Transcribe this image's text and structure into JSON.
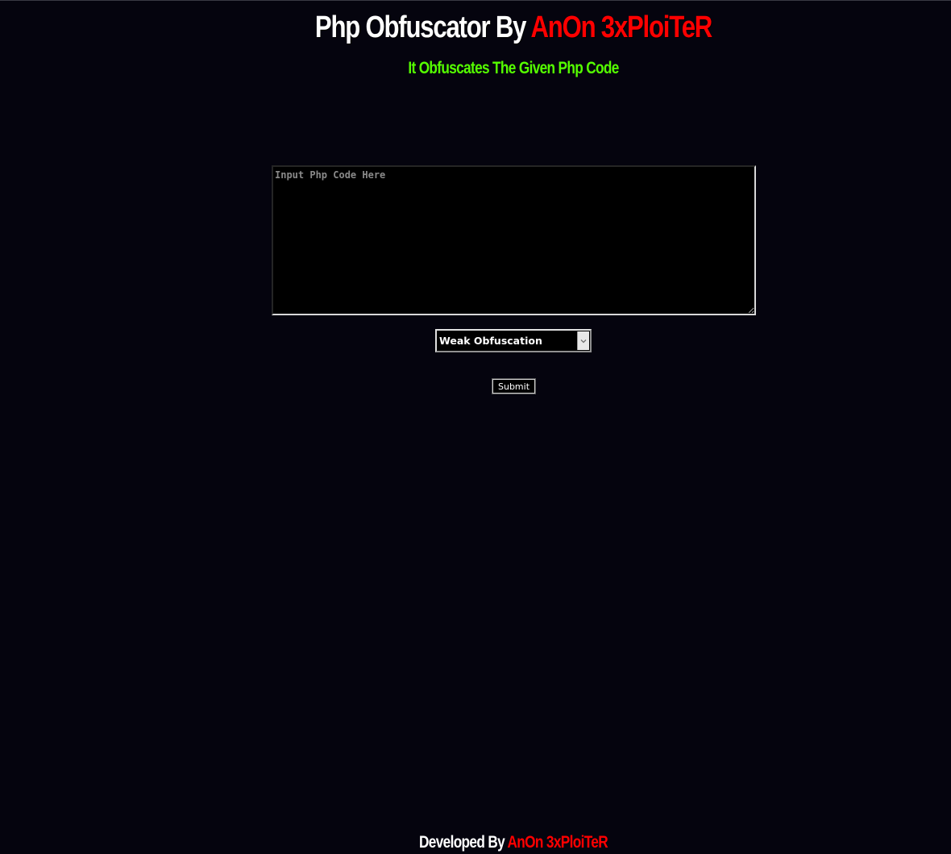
{
  "header": {
    "title_prefix": "Php Obfuscator By ",
    "title_author": "AnOn 3xPloiTeR",
    "subtitle": "It Obfuscates The Given Php Code"
  },
  "form": {
    "code_input": {
      "value": "",
      "placeholder": "Input Php Code Here"
    },
    "mode_select": {
      "selected": "Weak Obfuscation",
      "arrow_icon": "chevron-down-icon"
    },
    "submit_label": "Submit"
  },
  "footer": {
    "prefix": "Developed By ",
    "author": "AnOn 3xPloiTeR"
  },
  "colors": {
    "background": "#05040e",
    "accent_red": "#ff0000",
    "subtitle_green": "#55ff00",
    "text_white": "#ffffff"
  }
}
